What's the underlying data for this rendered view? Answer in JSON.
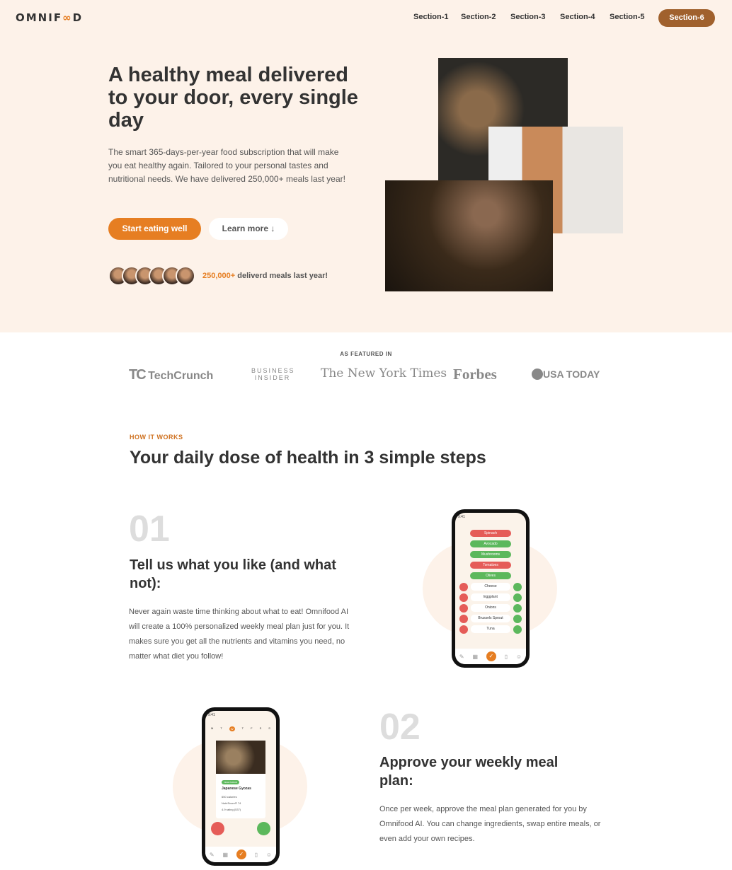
{
  "brand": {
    "logo": "OMNIFOOD",
    "accent": "#e67e22"
  },
  "nav": [
    "Section-1",
    "Section-2",
    "Section-3",
    "Section-4",
    "Section-5",
    "Section-6"
  ],
  "hero": {
    "title": "A healthy meal delivered to your door, every single day",
    "description": "The smart 365-days-per-year food subscription that will make you eat healthy again. Tailored to your personal tastes and nutritional needs. We have delivered 250,000+ meals last year!",
    "primary_button": "Start eating well",
    "secondary_button": "Learn more ↓",
    "delivered_count": "250,000+",
    "delivered_text": " deliverd meals last year!"
  },
  "featured": {
    "label": "AS FEATURED IN",
    "logos": [
      "TechCrunch",
      "BUSINESS INSIDER",
      "The New York Times",
      "Forbes",
      "USA TODAY"
    ]
  },
  "how": {
    "subheading": "HOW IT WORKS",
    "heading": "Your daily dose of health in 3 simple steps",
    "steps": [
      {
        "number": "01",
        "title": "Tell us what you like (and what not):",
        "text": "Never again waste time thinking about what to eat! Omnifood AI will create a 100% personalized weekly meal plan just for you. It makes sure you get all the nutrients and vitamins you need, no matter what diet you follow!"
      },
      {
        "number": "02",
        "title": "Approve your weekly meal plan:",
        "text": "Once per week, approve the meal plan generated for you by Omnifood AI. You can change ingredients, swap entire meals, or even add your own recipes."
      }
    ]
  },
  "phone1": {
    "time": "9:41",
    "pills": [
      {
        "label": "Spinach",
        "color": "#e55c58"
      },
      {
        "label": "Avocado",
        "color": "#5cb85c"
      },
      {
        "label": "Mushrooms",
        "color": "#5cb85c"
      },
      {
        "label": "Tomatoes",
        "color": "#e55c58"
      },
      {
        "label": "Olives",
        "color": "#5cb85c"
      }
    ],
    "rows": [
      "Cheese",
      "Eggplant",
      "Onions",
      "Brussels Sprout",
      "Tuna"
    ]
  },
  "phone2": {
    "time": "9:41",
    "days": [
      "M",
      "T",
      "W",
      "T",
      "F",
      "S",
      "S"
    ],
    "tag": "VEGETARIAN",
    "meal": "Japanese Gyozas",
    "calories": "650 calories",
    "nutriscore": "NutriScore® 74",
    "rating": "4.9 rating (537)"
  }
}
